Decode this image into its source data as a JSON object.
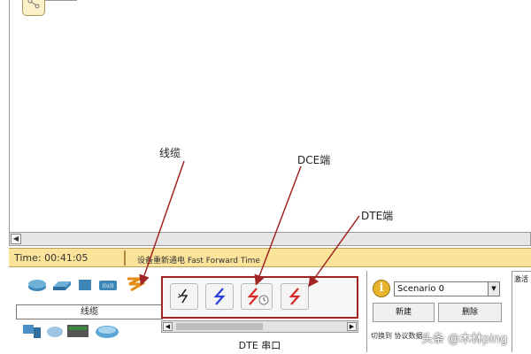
{
  "annotations": {
    "cable": "线缆",
    "dce": "DCE端",
    "dte": "DTE端"
  },
  "timebar": {
    "time": "Time: 00:41:05",
    "actions": "设备重新通电  Fast Forward Time"
  },
  "device_panel": {
    "category_label": "线缆"
  },
  "cable_panel": {
    "selected_name": "DTE 串口"
  },
  "scenario": {
    "selected": "Scenario 0",
    "new_button": "新建",
    "delete_button": "删除",
    "bottom_text": "切换到 协议数据"
  },
  "right_col": {
    "label": "激活"
  },
  "watermark": "头条 @木林ping",
  "colors": {
    "highlight_red": "#a12525",
    "timebar_bg": "#fbe39a",
    "cable_blue": "#2a3fd6",
    "cable_red": "#d42a2a"
  }
}
